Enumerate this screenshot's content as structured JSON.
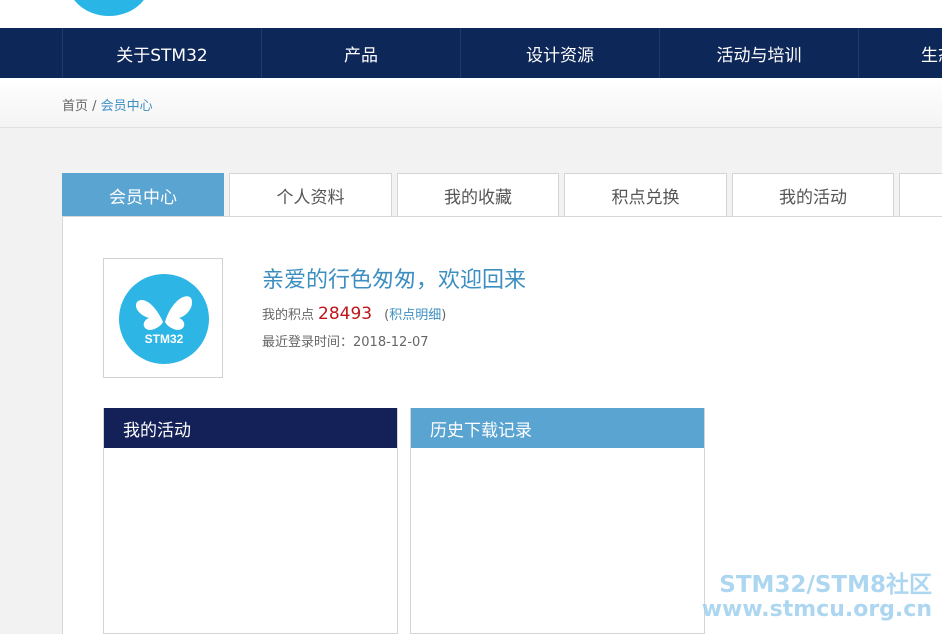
{
  "nav": {
    "items": [
      "关于STM32",
      "产品",
      "设计资源",
      "活动与培训",
      "生态"
    ]
  },
  "breadcrumb": {
    "home": "首页",
    "separator": " / ",
    "current": "会员中心"
  },
  "tabs": [
    "会员中心",
    "个人资料",
    "我的收藏",
    "积点兑换",
    "我的活动"
  ],
  "profile": {
    "avatar_text": "STM32",
    "welcome": "亲爱的行色匆匆，欢迎回来",
    "points_label": "我的积点",
    "points_value": "28493",
    "points_detail_open": "(",
    "points_detail_link": "积点明细",
    "points_detail_close": ")",
    "last_login_label": "最近登录时间：",
    "last_login_value": "2018-12-07"
  },
  "panels": {
    "activities_title": "我的活动",
    "downloads_title": "历史下载记录"
  },
  "watermark": {
    "line1": "STM32/STM8社区",
    "line2": "www.stmcu.org.cn"
  },
  "colors": {
    "nav_bg": "#0e2759",
    "accent_blue": "#5aa4d2",
    "link_blue": "#3d8fc2",
    "points_red": "#c0141b",
    "dark_panel": "#142159"
  }
}
